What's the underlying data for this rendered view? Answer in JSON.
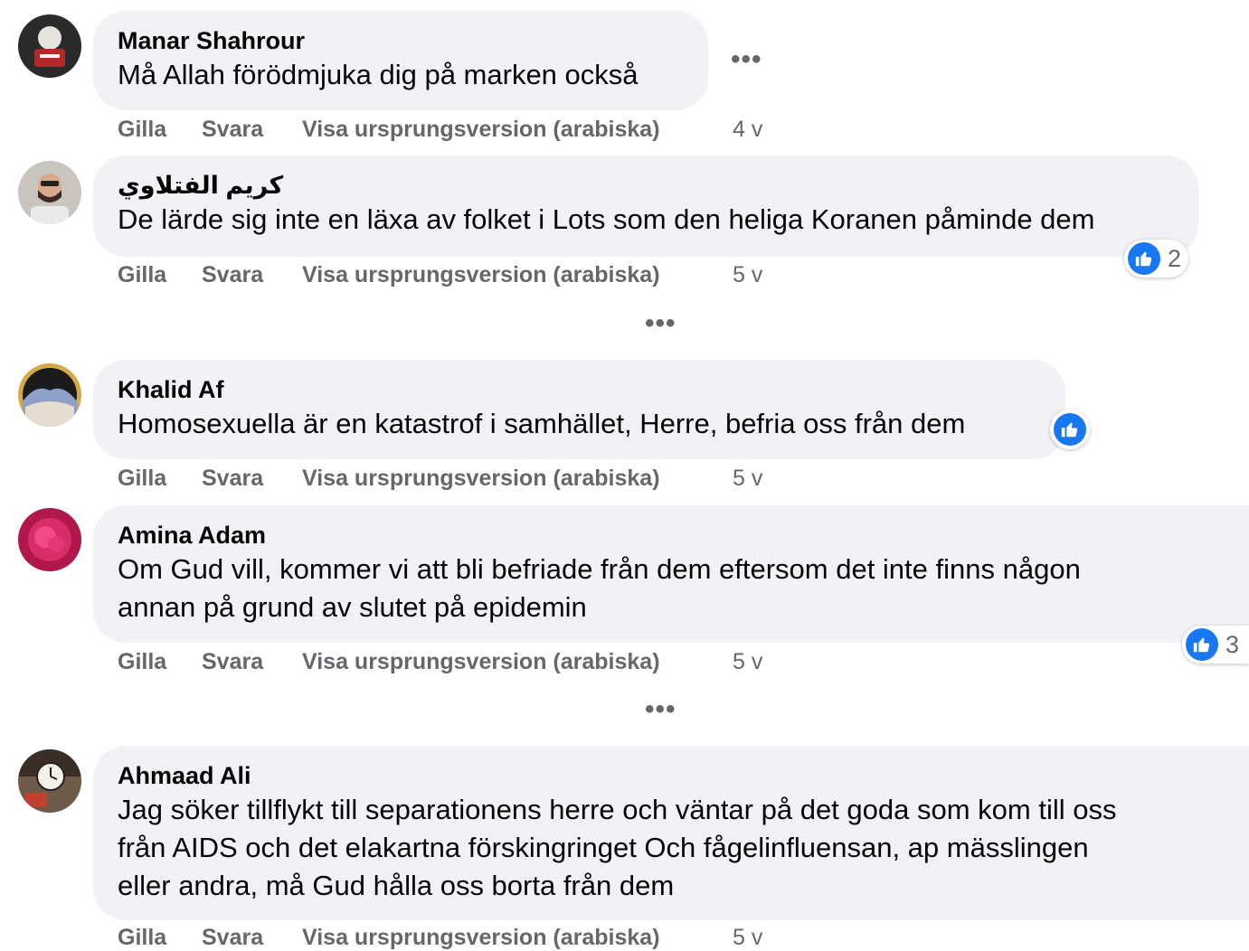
{
  "comments": [
    {
      "author": "Manar Shahrour",
      "text": "Må Allah förödmjuka dig på marken också",
      "like": "Gilla",
      "reply": "Svara",
      "translation": "Visa ursprungsversion (arabiska)",
      "time": "4 v"
    },
    {
      "author": "كريم الفتلاوي",
      "text": "De lärde sig inte en läxa av folket i Lots som den heliga Koranen påminde dem",
      "like": "Gilla",
      "reply": "Svara",
      "translation": "Visa ursprungsversion (arabiska)",
      "time": "5 v",
      "reaction_count": "2"
    },
    {
      "author": "Khalid Af",
      "text": "Homosexuella är en katastrof i samhället, Herre, befria oss från dem",
      "like": "Gilla",
      "reply": "Svara",
      "translation": "Visa ursprungsversion (arabiska)",
      "time": "5 v"
    },
    {
      "author": "Amina Adam",
      "text_lines": [
        "Om Gud vill, kommer vi att bli befriade från dem eftersom det inte finns någon",
        "annan på grund av slutet på epidemin"
      ],
      "like": "Gilla",
      "reply": "Svara",
      "translation": "Visa ursprungsversion (arabiska)",
      "time": "5 v",
      "reaction_count": "3"
    },
    {
      "author": "Ahmaad Ali",
      "text_lines": [
        "Jag söker tillflykt till separationens herre och väntar på det goda som kom till oss",
        "från AIDS och det elakartna förskingringet Och fågelinfluensan, ap mässlingen",
        "eller andra, må Gud hålla oss borta från dem"
      ],
      "like": "Gilla",
      "reply": "Svara",
      "translation": "Visa ursprungsversion (arabiska)",
      "time": "5 v"
    }
  ],
  "more_dots": "•••",
  "icons": {
    "reaction": "like-thumbs-up-icon",
    "options": "more-options-icon"
  },
  "colors": {
    "bubble": "#f0f2f5",
    "like_blue": "#1877f2",
    "meta_gray": "#65676b"
  }
}
